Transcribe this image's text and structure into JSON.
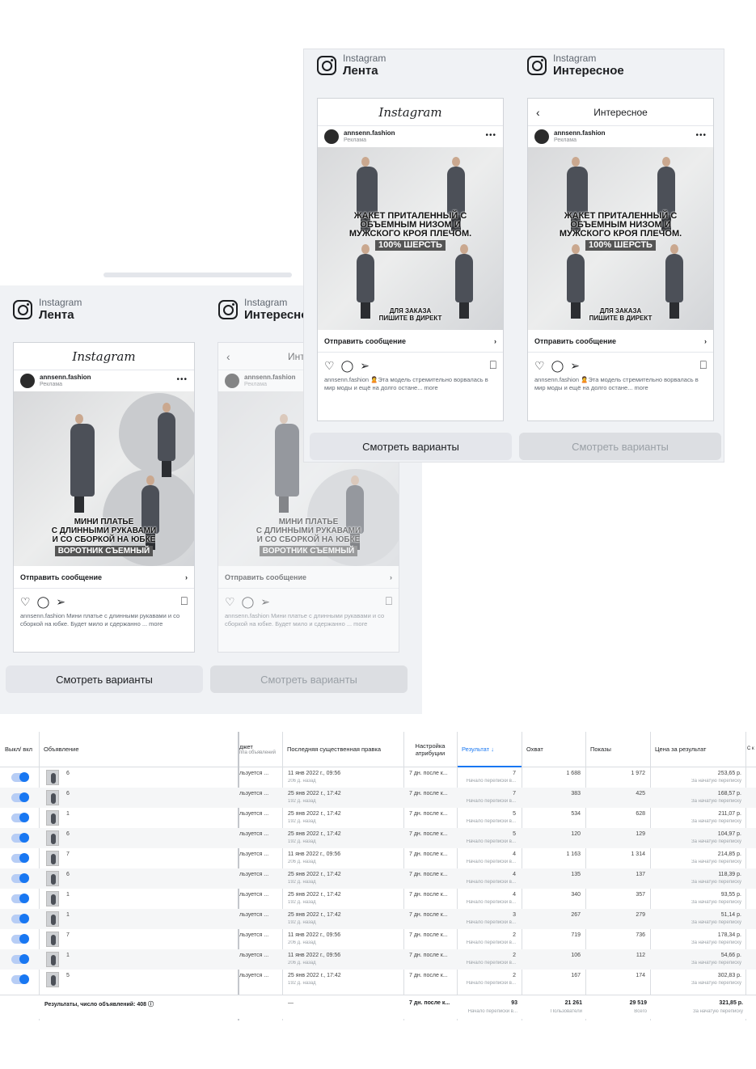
{
  "previews": {
    "feed_header": {
      "network": "Instagram",
      "placement": "Лента"
    },
    "explore_header": {
      "network": "Instagram",
      "placement": "Интересное"
    },
    "explore_title": "Интересное",
    "account": "annsenn.fashion",
    "sponsored": "Реклама",
    "cta": "Отправить сообщение",
    "more_btn": "Смотреть варианты",
    "ad_jacket": {
      "line1": "ЖАКЕТ ПРИТАЛЕННЫЙ С",
      "line2": "ОБЪЕМНЫМ НИЗОМ И",
      "line3": "МУЖСКОГО КРОЯ ПЛЕЧОМ.",
      "pill": "100% ШЕРСТЬ",
      "order1": "ДЛЯ ЗАКАЗА",
      "order2": "ПИШИТЕ В ДИРЕКТ",
      "caption": "annsenn.fashion 🙎Эта модель стремительно ворвалась в мир моды и ещё на долго остане... more"
    },
    "ad_dress": {
      "line1": "МИНИ ПЛАТЬЕ",
      "line2": "С ДЛИННЫМИ РУКАВАМИ",
      "line3": "И СО СБОРКОЙ НА ЮБКЕ",
      "pill": "ВОРОТНИК СЪЕМНЫЙ",
      "caption": "annsenn.fashion Мини платье с длинными рукавами и со сборкой на юбке. Будет мило и сдержанно ... more"
    }
  },
  "table": {
    "headers": {
      "toggle": "Выкл/ вкл",
      "ad": "Объявление",
      "budget": "джет",
      "budget_sub": "ппа объявлений",
      "edit": "Последняя существенная правка",
      "attr": "Настройка атрибуции",
      "result": "Результат ↓",
      "reach": "Охват",
      "impr": "Показы",
      "cpr": "Цена за результат",
      "extra": "С к"
    },
    "rows": [
      {
        "n": "6",
        "budget": "льзуется ...",
        "date": "11 янв 2022 г., 09:56",
        "ago": "206 д. назад",
        "attr": "7 дн. после к...",
        "res": "7",
        "res_sub": "Начало переписки в...",
        "reach": "1 688",
        "impr": "1 972",
        "cpr": "253,65 р.",
        "cpr_sub": "За начатую переписку"
      },
      {
        "n": "6",
        "budget": "льзуется ...",
        "date": "25 янв 2022 г., 17:42",
        "ago": "192 д. назад",
        "attr": "7 дн. после к...",
        "res": "7",
        "res_sub": "Начало переписки в...",
        "reach": "383",
        "impr": "425",
        "cpr": "168,57 р.",
        "cpr_sub": "За начатую переписку"
      },
      {
        "n": "1",
        "budget": "льзуется ...",
        "date": "25 янв 2022 г., 17:42",
        "ago": "192 д. назад",
        "attr": "7 дн. после к...",
        "res": "5",
        "res_sub": "Начало переписки в...",
        "reach": "534",
        "impr": "628",
        "cpr": "211,07 р.",
        "cpr_sub": "За начатую переписку"
      },
      {
        "n": "6",
        "budget": "льзуется ...",
        "date": "25 янв 2022 г., 17:42",
        "ago": "192 д. назад",
        "attr": "7 дн. после к...",
        "res": "5",
        "res_sub": "Начало переписки в...",
        "reach": "120",
        "impr": "129",
        "cpr": "104,97 р.",
        "cpr_sub": "За начатую переписку"
      },
      {
        "n": "7",
        "budget": "льзуется ...",
        "date": "11 янв 2022 г., 09:56",
        "ago": "206 д. назад",
        "attr": "7 дн. после к...",
        "res": "4",
        "res_sub": "Начало переписки в...",
        "reach": "1 163",
        "impr": "1 314",
        "cpr": "214,85 р.",
        "cpr_sub": "За начатую переписку"
      },
      {
        "n": "6",
        "budget": "льзуется ...",
        "date": "25 янв 2022 г., 17:42",
        "ago": "192 д. назад",
        "attr": "7 дн. после к...",
        "res": "4",
        "res_sub": "Начало переписки в...",
        "reach": "135",
        "impr": "137",
        "cpr": "118,39 р.",
        "cpr_sub": "За начатую переписку"
      },
      {
        "n": "1",
        "budget": "льзуется ...",
        "date": "25 янв 2022 г., 17:42",
        "ago": "192 д. назад",
        "attr": "7 дн. после к...",
        "res": "4",
        "res_sub": "Начало переписки в...",
        "reach": "340",
        "impr": "357",
        "cpr": "93,55 р.",
        "cpr_sub": "За начатую переписку"
      },
      {
        "n": "1",
        "budget": "льзуется ...",
        "date": "25 янв 2022 г., 17:42",
        "ago": "192 д. назад",
        "attr": "7 дн. после к...",
        "res": "3",
        "res_sub": "Начало переписки в...",
        "reach": "267",
        "impr": "279",
        "cpr": "51,14 р.",
        "cpr_sub": "За начатую переписку"
      },
      {
        "n": "7",
        "budget": "льзуется ...",
        "date": "11 янв 2022 г., 09:56",
        "ago": "206 д. назад",
        "attr": "7 дн. после к...",
        "res": "2",
        "res_sub": "Начало переписки в...",
        "reach": "719",
        "impr": "736",
        "cpr": "178,34 р.",
        "cpr_sub": "За начатую переписку"
      },
      {
        "n": "1",
        "budget": "льзуется ...",
        "date": "11 янв 2022 г., 09:56",
        "ago": "206 д. назад",
        "attr": "7 дн. после к...",
        "res": "2",
        "res_sub": "Начало переписки в...",
        "reach": "106",
        "impr": "112",
        "cpr": "54,66 р.",
        "cpr_sub": "За начатую переписку"
      },
      {
        "n": "5",
        "budget": "льзуется ...",
        "date": "25 янв 2022 г., 17:42",
        "ago": "192 д. назад",
        "attr": "7 дн. после к...",
        "res": "2",
        "res_sub": "Начало переписки в...",
        "reach": "167",
        "impr": "174",
        "cpr": "302,83 р.",
        "cpr_sub": "За начатую переписку"
      }
    ],
    "totals": {
      "label": "Результаты, число объявлений: 408",
      "edit": "—",
      "attr": "7 дн. после к...",
      "res": "93",
      "res_sub": "Начало переписки в...",
      "reach": "21 261",
      "reach_sub": "Пользователи",
      "impr": "29 519",
      "impr_sub": "Всего",
      "cpr": "321,85 р.",
      "cpr_sub": "За начатую переписку"
    }
  }
}
